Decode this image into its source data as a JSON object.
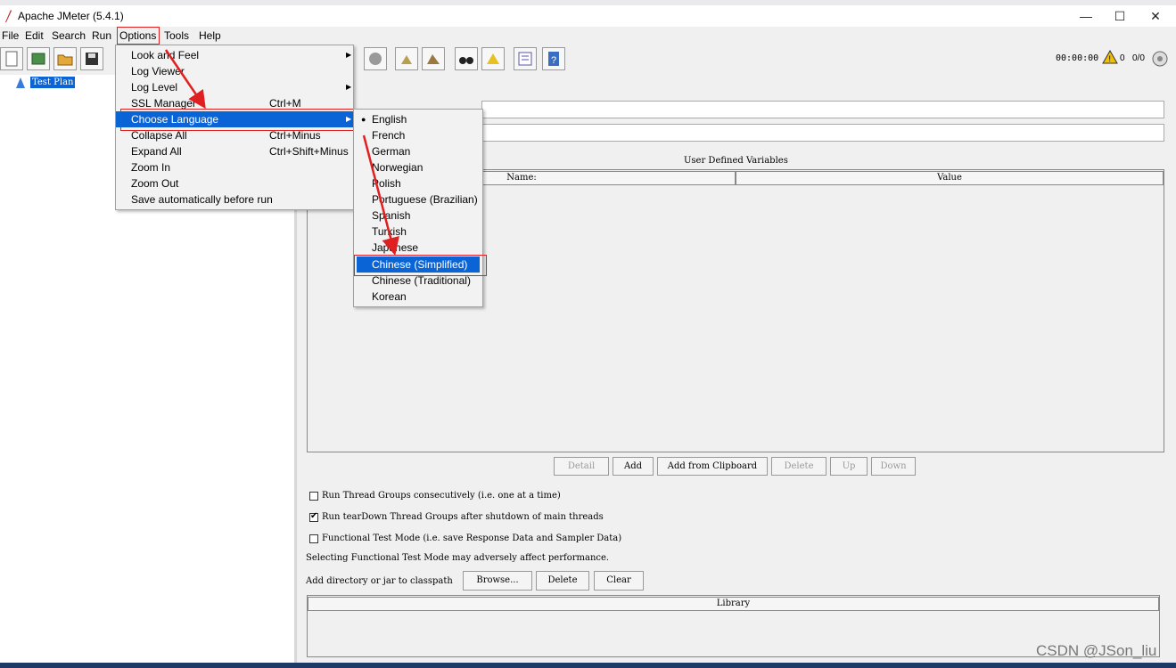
{
  "window": {
    "title": "Apache JMeter (5.4.1)",
    "minimize": "—",
    "maximize": "☐",
    "close": "✕"
  },
  "menubar": [
    "File",
    "Edit",
    "Search",
    "Run",
    "Options",
    "Tools",
    "Help"
  ],
  "toolbar": {
    "timer": "00:00:00",
    "warnings": "0",
    "threads": "0/0"
  },
  "tree": {
    "root": "Test Plan"
  },
  "test_plan": {
    "udv_title": "User Defined Variables",
    "columns": [
      "Name:",
      "Value"
    ],
    "buttons": [
      {
        "label": "Detail",
        "enabled": false
      },
      {
        "label": "Add",
        "enabled": true
      },
      {
        "label": "Add from Clipboard",
        "enabled": true
      },
      {
        "label": "Delete",
        "enabled": false
      },
      {
        "label": "Up",
        "enabled": false
      },
      {
        "label": "Down",
        "enabled": false
      }
    ],
    "checkboxes": [
      {
        "label": "Run Thread Groups consecutively (i.e. one at a time)",
        "checked": false
      },
      {
        "label": "Run tearDown Thread Groups after shutdown of main threads",
        "checked": true
      },
      {
        "label": "Functional Test Mode (i.e. save Response Data and Sampler Data)",
        "checked": false
      }
    ],
    "functional_note": "Selecting Functional Test Mode may adversely affect performance.",
    "classpath_label": "Add directory or jar to classpath",
    "classpath_buttons": [
      "Browse...",
      "Delete",
      "Clear"
    ],
    "library_header": "Library"
  },
  "options_menu": [
    {
      "label": "Look and Feel",
      "accel": "",
      "submenu": true
    },
    {
      "label": "Log Viewer",
      "accel": "",
      "submenu": false
    },
    {
      "label": "Log Level",
      "accel": "",
      "submenu": true
    },
    {
      "label": "SSL Manager",
      "accel": "Ctrl+M",
      "submenu": false
    },
    {
      "label": "Choose Language",
      "accel": "",
      "submenu": true
    },
    {
      "label": "Collapse All",
      "accel": "Ctrl+Minus",
      "submenu": false
    },
    {
      "label": "Expand All",
      "accel": "Ctrl+Shift+Minus",
      "submenu": false
    },
    {
      "label": "Zoom In",
      "accel": "",
      "submenu": false
    },
    {
      "label": "Zoom Out",
      "accel": "",
      "submenu": false
    },
    {
      "label": "Save automatically before run",
      "accel": "",
      "submenu": false
    }
  ],
  "language_menu": [
    "English",
    "French",
    "German",
    "Norwegian",
    "Polish",
    "Portuguese (Brazilian)",
    "Spanish",
    "Turkish",
    "Japanese",
    "Chinese (Simplified)",
    "Chinese (Traditional)",
    "Korean"
  ],
  "language_current": "English",
  "language_highlighted": "Chinese (Simplified)",
  "watermark": "CSDN @JSon_liu",
  "colors": {
    "selection": "#0a64d6",
    "annotation": "#e02020"
  }
}
